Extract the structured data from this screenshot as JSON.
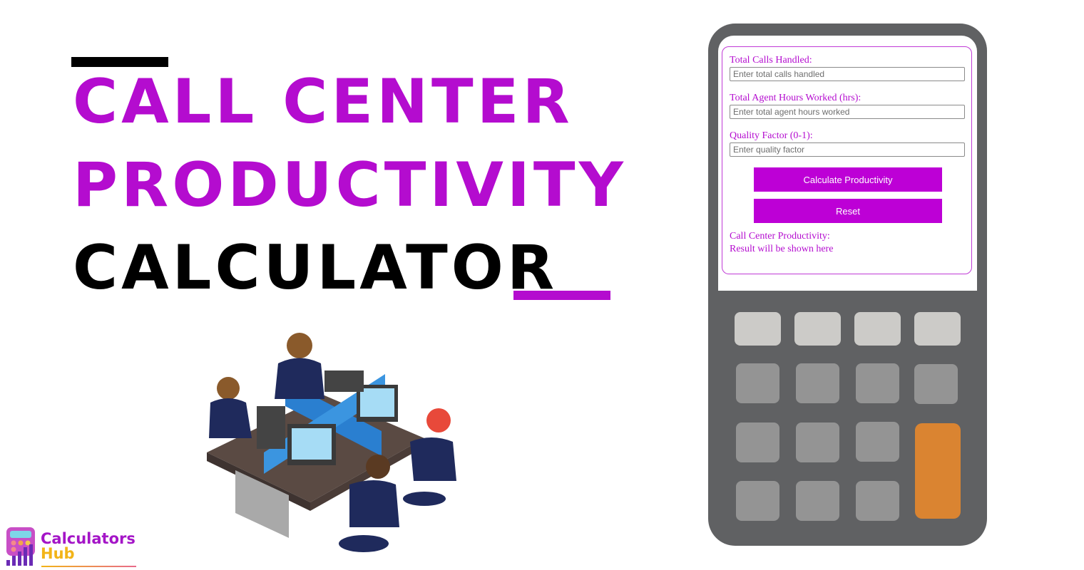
{
  "hero": {
    "title_line1": "Call Center",
    "title_line2": "Productivity",
    "title_line3": "Calculator",
    "accent_color": "#b40ccf"
  },
  "calculator_form": {
    "fields": [
      {
        "label": "Total Calls Handled:",
        "placeholder": "Enter total calls handled",
        "value": ""
      },
      {
        "label": "Total Agent Hours Worked (hrs):",
        "placeholder": "Enter total agent hours worked",
        "value": ""
      },
      {
        "label": "Quality Factor (0-1):",
        "placeholder": "Enter quality factor",
        "value": ""
      }
    ],
    "calculate_label": "Calculate Productivity",
    "reset_label": "Reset",
    "result_label": "Call Center Productivity:",
    "result_text": "Result will be shown here",
    "button_color": "#bd00d6"
  },
  "calculator_keys": {
    "colors": {
      "body": "#606163",
      "light": "#cccbc8",
      "mid": "#949494",
      "equals": "#da8431"
    }
  },
  "illustration": {
    "icon": "call-center-agents-illustration"
  },
  "logo": {
    "line1": "Calculators",
    "line2": "Hub",
    "icon": "calculator-chart-icon"
  }
}
